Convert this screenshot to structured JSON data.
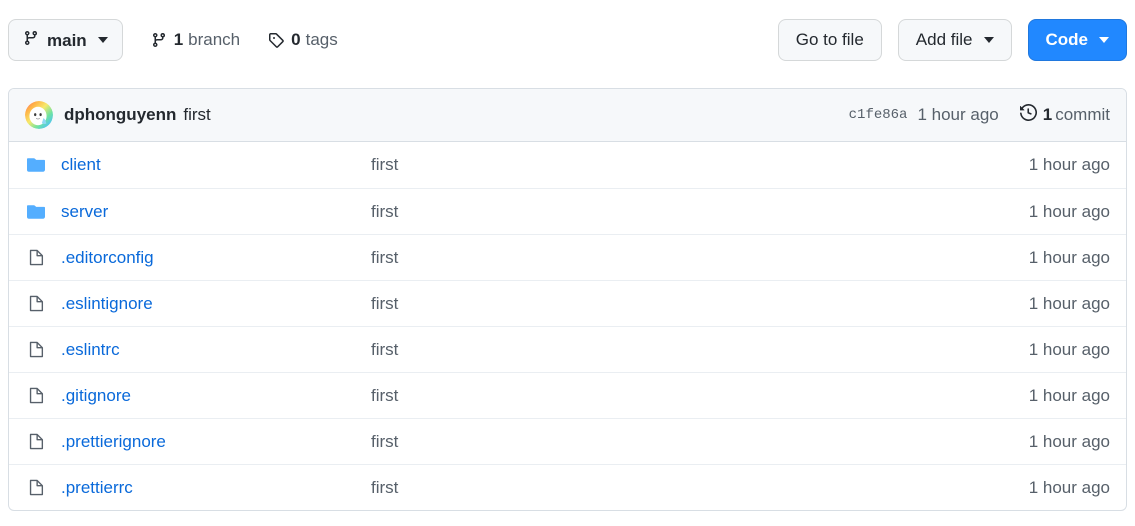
{
  "toolbar": {
    "branch_button": {
      "label": "main",
      "icon": "git-branch-icon",
      "caret": "chevron-down-icon"
    },
    "branch_stat": {
      "count": "1",
      "word": "branch",
      "icon": "git-branch-icon"
    },
    "tag_stat": {
      "count": "0",
      "word": "tags",
      "icon": "tag-icon"
    },
    "go_to_file_label": "Go to file",
    "add_file_label": "Add file",
    "code_label": "Code"
  },
  "commit_header": {
    "avatar": "user-avatar",
    "author": "dphonguyenn",
    "message": "first",
    "sha": "c1fe86a",
    "time": "1 hour ago",
    "commits_count": "1",
    "commits_word": "commit",
    "history_icon": "history-clock-icon"
  },
  "files": [
    {
      "name": "client",
      "type": "folder",
      "message": "first",
      "time": "1 hour ago"
    },
    {
      "name": "server",
      "type": "folder",
      "message": "first",
      "time": "1 hour ago"
    },
    {
      "name": ".editorconfig",
      "type": "file",
      "message": "first",
      "time": "1 hour ago"
    },
    {
      "name": ".eslintignore",
      "type": "file",
      "message": "first",
      "time": "1 hour ago"
    },
    {
      "name": ".eslintrc",
      "type": "file",
      "message": "first",
      "time": "1 hour ago"
    },
    {
      "name": ".gitignore",
      "type": "file",
      "message": "first",
      "time": "1 hour ago"
    },
    {
      "name": ".prettierignore",
      "type": "file",
      "message": "first",
      "time": "1 hour ago"
    },
    {
      "name": ".prettierrc",
      "type": "file",
      "message": "first",
      "time": "1 hour ago"
    }
  ],
  "colors": {
    "accent_blue": "#0969da",
    "code_button": "#2188ff",
    "folder_icon": "#54aeff",
    "muted_text": "#57606a",
    "header_bg": "#f6f8fa",
    "border": "#d8dee4"
  }
}
